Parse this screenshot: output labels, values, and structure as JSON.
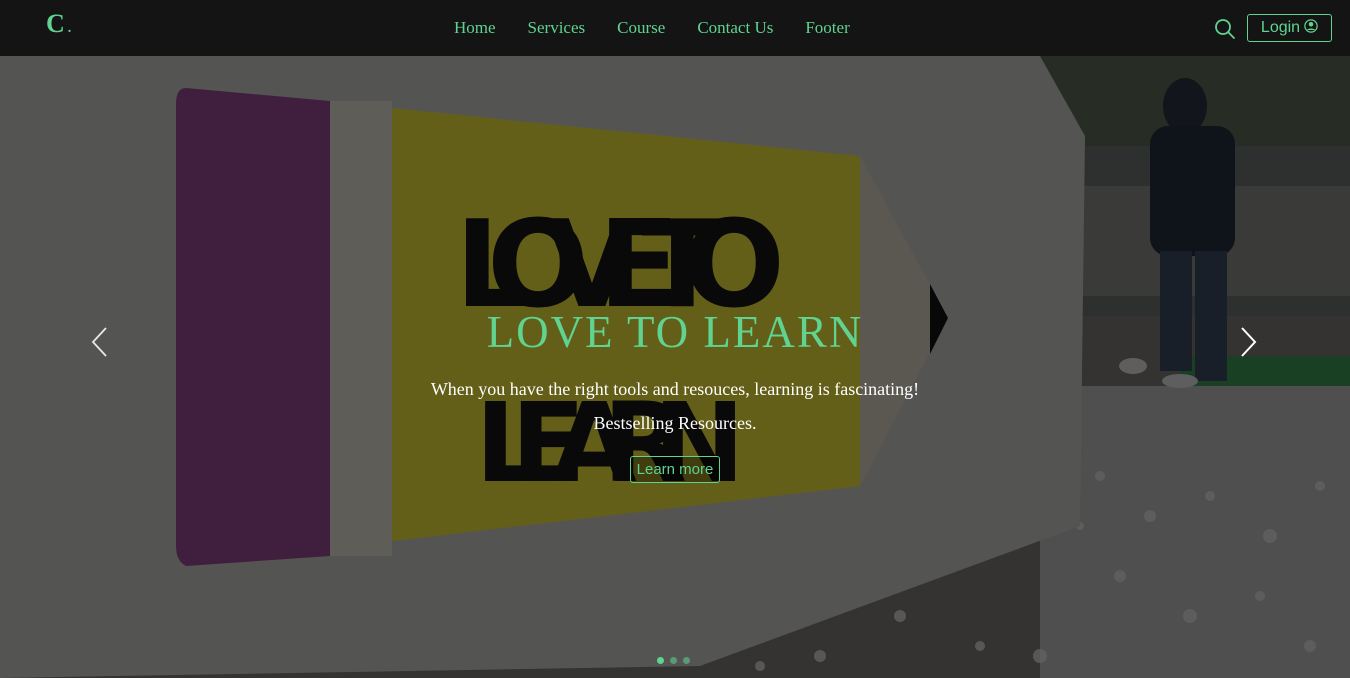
{
  "navbar": {
    "brand": "C",
    "brand_dot": ".",
    "links": [
      "Home",
      "Services",
      "Course",
      "Contact Us",
      "Footer"
    ],
    "login_label": "Login",
    "search_icon": "search-icon",
    "user_icon": "user-circle-icon"
  },
  "hero": {
    "background_icon": "pencil-sign-photo",
    "sign_text": "LOVE TO LEARN",
    "title": "LOVE TO LEARN",
    "line1": "When you have the right tools and resouces, learning is fascinating!",
    "line2": "Bestselling Resources.",
    "button_label": "Learn more",
    "prev_icon": "chevron-left-icon",
    "next_icon": "chevron-right-icon",
    "slides": 3,
    "active_slide": 1
  },
  "colors": {
    "accent": "#5fd38f",
    "navbar_bg": "#141414",
    "text": "#ffffff"
  }
}
